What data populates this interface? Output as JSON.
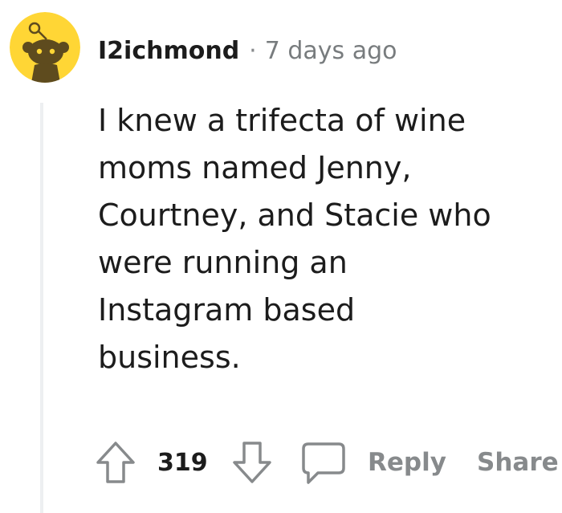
{
  "comment": {
    "username": "I2ichmond",
    "separator": "·",
    "timestamp": "7 days ago",
    "body_lines": [
      "I knew a trifecta of wine",
      "moms named Jenny,",
      "Courtney, and Stacie who",
      "were running an",
      "Instagram based",
      "business."
    ]
  },
  "actions": {
    "upvote_icon": "arrow-up-icon",
    "score": "319",
    "downvote_icon": "arrow-down-icon",
    "reply_icon": "speech-bubble-icon",
    "reply_label": "Reply",
    "share_label": "Share"
  },
  "colors": {
    "avatar_bg": "#FFD635",
    "avatar_figure": "#5e4b1e",
    "text": "#1c1c1c",
    "meta": "#787c7e",
    "action_gray": "#878a8c",
    "thread_line": "#edeff1"
  }
}
